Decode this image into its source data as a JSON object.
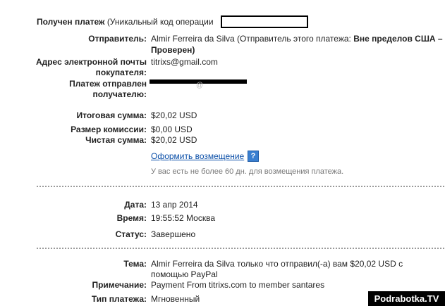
{
  "header": {
    "payment_received": "Получен платеж",
    "unique_code_label": "(Уникальный код операции"
  },
  "sender": {
    "label": "Отправитель:",
    "value_line1_prefix": "Almir Ferreira da Silva (Отправитель этого платежа: ",
    "value_line1_bold": "Вне пределов США –",
    "value_line2": "Проверен)"
  },
  "buyer_email": {
    "label_line1": "Адрес электронной почты",
    "label_line2": "покупателя:",
    "value": "titrixs@gmail.com"
  },
  "sent_to": {
    "label_line1": "Платеж отправлен",
    "label_line2": "получателю:",
    "visible_tail": "@"
  },
  "amounts": {
    "total_label": "Итоговая сумма:",
    "total_value": "$20,02 USD",
    "fee_label": "Размер комиссии:",
    "fee_value": "$0,00 USD",
    "net_label": "Чистая сумма:",
    "net_value": "$20,02 USD"
  },
  "refund": {
    "link": "Оформить возмещение",
    "help_icon": "?",
    "note": "У вас есть не более 60 дн. для возмещения платежа."
  },
  "details": {
    "date_label": "Дата:",
    "date_value": "13 апр 2014",
    "time_label": "Время:",
    "time_value": "19:55:52 Москва",
    "status_label": "Статус:",
    "status_value": "Завершено"
  },
  "message": {
    "subject_label": "Тема:",
    "subject_line1": "Almir Ferreira da Silva только что отправил(-а) вам $20,02 USD с",
    "subject_line2": "помощью PayPal",
    "note_label": "Примечание:",
    "note_value": "Payment From titrixs.com to member santares",
    "type_label": "Тип платежа:",
    "type_value": "Мгновенный"
  },
  "watermark": "Podrabotka.TV"
}
